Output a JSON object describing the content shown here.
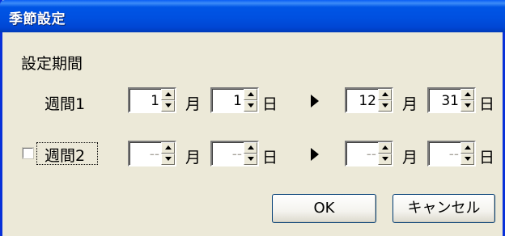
{
  "window": {
    "title": "季節設定"
  },
  "section_label": "設定期間",
  "unit_month": "月",
  "unit_day": "日",
  "play_icon": "right-arrow-icon",
  "week1": {
    "label": "週間1",
    "start_month": "1",
    "start_day": "1",
    "end_month": "12",
    "end_day": "31"
  },
  "week2": {
    "label": "週間2",
    "checked": false,
    "start_month": "--",
    "start_day": "--",
    "end_month": "--",
    "end_day": "--"
  },
  "buttons": {
    "ok": "OK",
    "cancel": "キャンセル"
  }
}
